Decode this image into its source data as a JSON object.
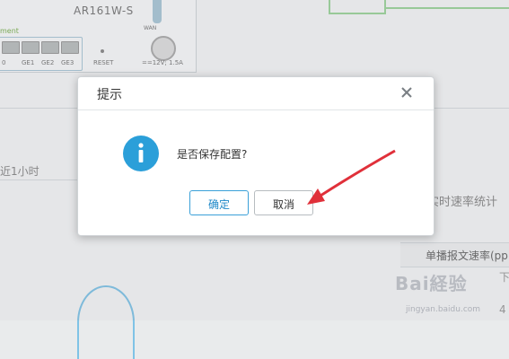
{
  "background": {
    "device_model": "AR161W-S",
    "port_group_label": "ment",
    "ports": [
      "0",
      "GE1",
      "GE2",
      "GE3"
    ],
    "reset_label": "RESET",
    "wan_label": "WAN",
    "power_label": "==12V; 1.5A",
    "recent_label": "近1小时",
    "rate_stats_title": "实时速率统计",
    "unicast_rate_header": "单播报文速率(pp",
    "partial_cell": "下",
    "partial_cell_2": "4"
  },
  "dialog": {
    "title": "提示",
    "message": "是否保存配置?",
    "ok_label": "确定",
    "cancel_label": "取消"
  },
  "watermark": {
    "logo_text": "Bai経验",
    "url": "jingyan.baidu.com"
  },
  "colors": {
    "primary": "#1e88c8",
    "info_icon": "#2b9fd9",
    "arrow": "#e0303a",
    "link_green": "#9dd49b"
  },
  "icons": {
    "close": "close-icon",
    "info": "info-icon",
    "annotation": "red-arrow-icon"
  }
}
